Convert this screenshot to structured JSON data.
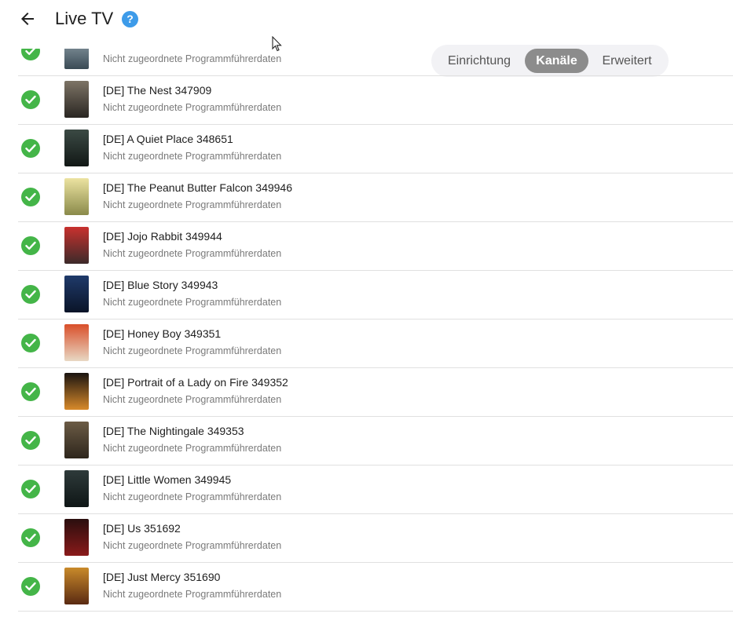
{
  "header": {
    "title": "Live TV",
    "help_symbol": "?"
  },
  "tabs": [
    {
      "label": "Einrichtung",
      "selected": false
    },
    {
      "label": "Kanäle",
      "selected": true
    },
    {
      "label": "Erweitert",
      "selected": false
    }
  ],
  "status_color": "#44b548",
  "channels": [
    {
      "name": "",
      "subtitle": "Nicht zugeordnete Programmführerdaten",
      "poster_colors": [
        "#9fb0b8",
        "#3a4a55"
      ]
    },
    {
      "name": "[DE] The Nest 347909",
      "subtitle": "Nicht zugeordnete Programmführerdaten",
      "poster_colors": [
        "#7d7466",
        "#2a2622"
      ]
    },
    {
      "name": "[DE] A Quiet Place 348651",
      "subtitle": "Nicht zugeordnete Programmführerdaten",
      "poster_colors": [
        "#3b4a44",
        "#121816"
      ]
    },
    {
      "name": "[DE] The Peanut Butter Falcon 349946",
      "subtitle": "Nicht zugeordnete Programmführerdaten",
      "poster_colors": [
        "#ece3a1",
        "#8a8a4a"
      ]
    },
    {
      "name": "[DE] Jojo Rabbit 349944",
      "subtitle": "Nicht zugeordnete Programmführerdaten",
      "poster_colors": [
        "#c8312e",
        "#3c2a2a"
      ]
    },
    {
      "name": "[DE] Blue Story 349943",
      "subtitle": "Nicht zugeordnete Programmführerdaten",
      "poster_colors": [
        "#1f3a6a",
        "#0a1428"
      ]
    },
    {
      "name": "[DE] Honey Boy 349351",
      "subtitle": "Nicht zugeordnete Programmführerdaten",
      "poster_colors": [
        "#d94f2a",
        "#e8d8c4"
      ]
    },
    {
      "name": "[DE] Portrait of a Lady on Fire 349352",
      "subtitle": "Nicht zugeordnete Programmführerdaten",
      "poster_colors": [
        "#1a1410",
        "#d88a2a"
      ]
    },
    {
      "name": "[DE] The Nightingale 349353",
      "subtitle": "Nicht zugeordnete Programmführerdaten",
      "poster_colors": [
        "#6b5b45",
        "#2e261c"
      ]
    },
    {
      "name": "[DE] Little Women 349945",
      "subtitle": "Nicht zugeordnete Programmführerdaten",
      "poster_colors": [
        "#2e3a3a",
        "#0f1616"
      ]
    },
    {
      "name": "[DE] Us 351692",
      "subtitle": "Nicht zugeordnete Programmführerdaten",
      "poster_colors": [
        "#2a0e0e",
        "#8a1a1a"
      ]
    },
    {
      "name": "[DE] Just Mercy 351690",
      "subtitle": "Nicht zugeordnete Programmführerdaten",
      "poster_colors": [
        "#c98a2a",
        "#5a2a12"
      ]
    }
  ]
}
